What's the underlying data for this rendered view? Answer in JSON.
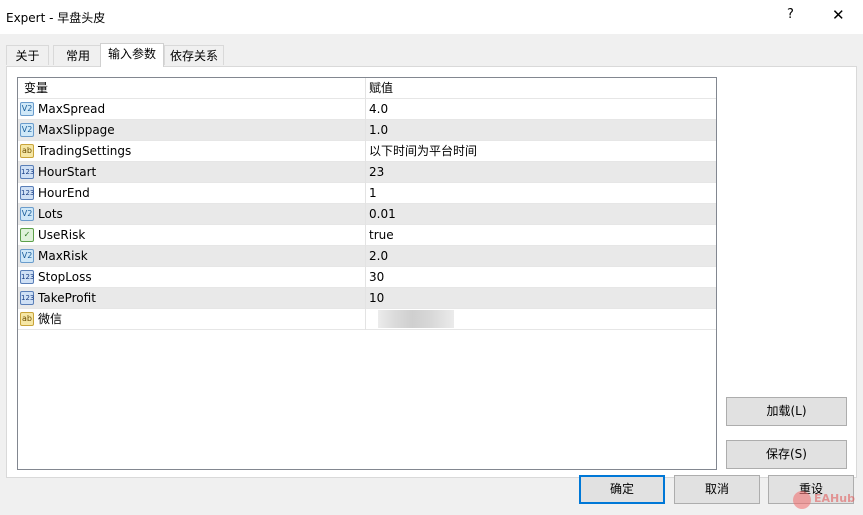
{
  "window": {
    "title": "Expert - 早盘头皮",
    "help_label": "?",
    "close_label": "✕"
  },
  "tabs": [
    {
      "label": "关于"
    },
    {
      "label": "常用"
    },
    {
      "label": "输入参数"
    },
    {
      "label": "依存关系"
    }
  ],
  "active_tab": "输入参数",
  "grid": {
    "headers": {
      "variable": "变量",
      "value": "赋值"
    },
    "rows": [
      {
        "type": "double",
        "icon": "V2",
        "name": "MaxSpread",
        "value": "4.0"
      },
      {
        "type": "double",
        "icon": "V2",
        "name": "MaxSlippage",
        "value": "1.0"
      },
      {
        "type": "string",
        "icon": "ab",
        "name": "TradingSettings",
        "value": "以下时间为平台时间"
      },
      {
        "type": "int",
        "icon": "123",
        "name": "HourStart",
        "value": "23"
      },
      {
        "type": "int",
        "icon": "123",
        "name": "HourEnd",
        "value": "1"
      },
      {
        "type": "double",
        "icon": "V2",
        "name": "Lots",
        "value": "0.01"
      },
      {
        "type": "bool",
        "icon": "✓",
        "name": "UseRisk",
        "value": "true"
      },
      {
        "type": "double",
        "icon": "V2",
        "name": "MaxRisk",
        "value": "2.0"
      },
      {
        "type": "int",
        "icon": "123",
        "name": "StopLoss",
        "value": "30"
      },
      {
        "type": "int",
        "icon": "123",
        "name": "TakeProfit",
        "value": "10"
      },
      {
        "type": "string",
        "icon": "ab",
        "name": "微信",
        "value": ""
      }
    ]
  },
  "buttons": {
    "load": "加载(L)",
    "save": "保存(S)",
    "ok": "确定",
    "cancel": "取消",
    "reset": "重设"
  },
  "watermark": {
    "text": "EAHub"
  },
  "colors": {
    "accent": "#0078d7",
    "grid_border": "#828790",
    "alt_row": "#e9e9e9"
  }
}
